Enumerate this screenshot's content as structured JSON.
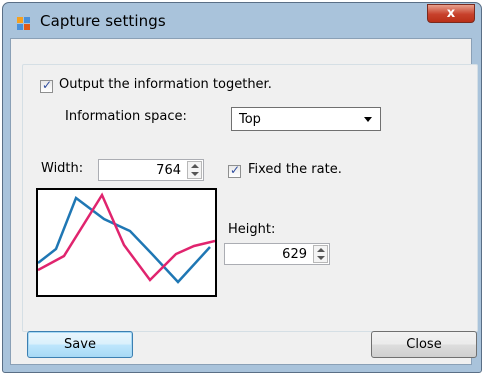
{
  "window": {
    "title": "Capture settings",
    "close_glyph": "x",
    "icon": "app-window-icon"
  },
  "output_together": {
    "label": "Output the information together.",
    "checked": true
  },
  "info_space": {
    "label": "Information space:",
    "selected": "Top"
  },
  "width": {
    "label": "Width:",
    "value": "764"
  },
  "fixed_rate": {
    "label": "Fixed the rate.",
    "checked": true
  },
  "height": {
    "label": "Height:",
    "value": "629"
  },
  "buttons": {
    "save": "Save",
    "close": "Close"
  },
  "preview_colors": {
    "blue": "#1f77b4",
    "pink": "#e0246e"
  }
}
